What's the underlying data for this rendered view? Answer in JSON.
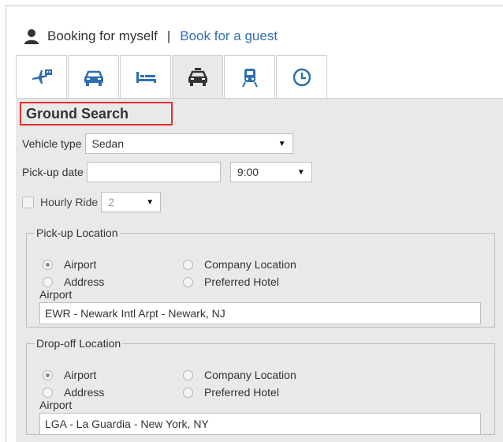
{
  "booking": {
    "self_label": "Booking for myself",
    "separator": "|",
    "guest_label": "Book for a guest"
  },
  "tabs": [
    {
      "icon": "airplane-hotel-icon"
    },
    {
      "icon": "car-icon"
    },
    {
      "icon": "bed-icon"
    },
    {
      "icon": "taxi-icon",
      "active": true
    },
    {
      "icon": "train-icon"
    },
    {
      "icon": "clock-icon"
    }
  ],
  "ground_search": {
    "title": "Ground Search",
    "vehicle_type_label": "Vehicle type",
    "vehicle_type_value": "Sedan",
    "pickup_date_label": "Pick-up date",
    "pickup_date_value": "",
    "pickup_time_value": "9:00",
    "hourly_ride_label": "Hourly Ride",
    "hourly_ride_value": "2"
  },
  "pickup": {
    "legend": "Pick-up Location",
    "options": {
      "airport": "Airport",
      "company": "Company Location",
      "address": "Address",
      "hotel": "Preferred Hotel"
    },
    "selected": "airport",
    "field_label": "Airport",
    "field_value": "EWR - Newark Intl Arpt - Newark, NJ"
  },
  "dropoff": {
    "legend": "Drop-off Location",
    "options": {
      "airport": "Airport",
      "company": "Company Location",
      "address": "Address",
      "hotel": "Preferred Hotel"
    },
    "selected": "airport",
    "field_label": "Airport",
    "field_value": "LGA - La Guardia - New York, NY"
  },
  "colors": {
    "link": "#2f6fb0",
    "highlight_border": "#e03030",
    "panel_bg": "#e9e9e9"
  }
}
